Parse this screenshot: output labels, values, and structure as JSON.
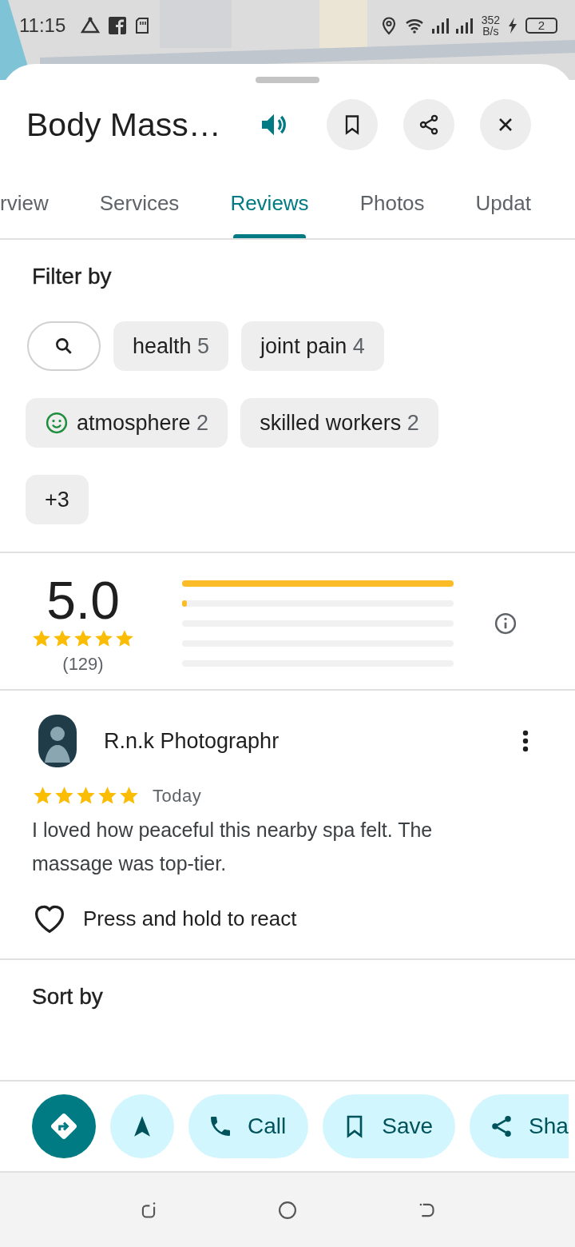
{
  "status_bar": {
    "time": "11:15",
    "speed": "352",
    "speed_unit": "B/s",
    "battery": "2"
  },
  "header": {
    "title": "Body Mass…"
  },
  "tabs": [
    {
      "label": "rview",
      "selected": false
    },
    {
      "label": "Services",
      "selected": false
    },
    {
      "label": "Reviews",
      "selected": true
    },
    {
      "label": "Photos",
      "selected": false
    },
    {
      "label": "Updat",
      "selected": false
    }
  ],
  "filter": {
    "title": "Filter by",
    "chips": [
      {
        "kind": "search"
      },
      {
        "kind": "topic",
        "label": "health",
        "count": "5"
      },
      {
        "kind": "topic",
        "label": "joint pain",
        "count": "4"
      },
      {
        "kind": "mood",
        "label": "atmosphere",
        "count": "2"
      },
      {
        "kind": "topic",
        "label": "skilled workers",
        "count": "2"
      },
      {
        "kind": "more",
        "label": "+3"
      }
    ]
  },
  "rating": {
    "score": "5.0",
    "stars": 5,
    "count": "(129)",
    "bars": [
      {
        "level": 1
      },
      {
        "level": 0.015
      }
    ]
  },
  "review": {
    "author": "R.n.k Photographr",
    "stars": 5,
    "time": "Today",
    "text": "I loved how peaceful this nearby spa felt. The massage was top-tier.",
    "react": "Press and hold to react"
  },
  "sort": {
    "title": "Sort by"
  },
  "actions": [
    {
      "kind": "directions"
    },
    {
      "kind": "start"
    },
    {
      "kind": "call",
      "label": "Call"
    },
    {
      "kind": "save",
      "label": "Save"
    },
    {
      "kind": "share",
      "label": "Sha"
    }
  ]
}
